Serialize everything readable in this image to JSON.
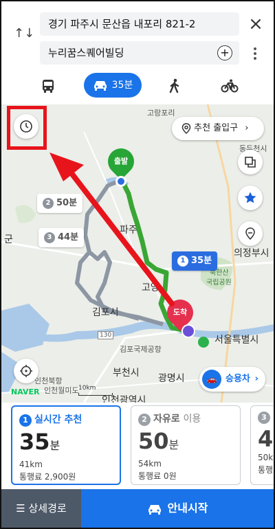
{
  "header": {
    "origin": "경기 파주시 문산읍 내포리 821-2",
    "destination": "누리꿈스퀘어빌딩",
    "swap_icon": "↑↓",
    "close_icon": "×",
    "plus_icon": "+",
    "more_icon": "⋮"
  },
  "modes": {
    "car_label": "35분"
  },
  "map": {
    "recommend_entrance": "추천 출입구",
    "origin_pin": "출발",
    "dest_pin": "도착",
    "route2": {
      "num": "2",
      "time": "50분"
    },
    "route3": {
      "num": "3",
      "time": "44분"
    },
    "route1": {
      "num": "1",
      "time": "35분"
    },
    "car_button": "승용차",
    "naver": "NAVER",
    "scale": "10km",
    "labels": {
      "goryangpo": "고랑포리",
      "dongducheon": "동두천시",
      "paju": "파주",
      "uijeongbu": "의정부시",
      "bukhansan": "북한산",
      "park": "국립공원",
      "goyang": "고양",
      "gimpo": "김포시",
      "seoul": "서울특별시",
      "airport": "김포국제공항",
      "bucheon": "부천시",
      "gwangmyeong": "광명시",
      "incheon": "인천광역시",
      "incheon_north": "인천북항",
      "wolmido": "인천월미도",
      "gun": "군",
      "road130": "130"
    }
  },
  "cards": [
    {
      "num": "1",
      "title": "실시간 추천",
      "sub": "",
      "time": "35",
      "unit": "분",
      "dist": "41km",
      "toll": "통행료 2,900원"
    },
    {
      "num": "2",
      "title": "자유로",
      "sub": "이용",
      "time": "50",
      "unit": "분",
      "dist": "54km",
      "toll": "통행료 0원"
    },
    {
      "num": "3",
      "title": "",
      "sub": "",
      "time": "4",
      "unit": "",
      "dist": "50k",
      "toll": "통행"
    }
  ],
  "bottom": {
    "detail": "상세경로",
    "start": "안내시작"
  },
  "colors": {
    "accent": "#1a73e8",
    "route_green": "#3aa635",
    "annotation_red": "#e8141c"
  }
}
